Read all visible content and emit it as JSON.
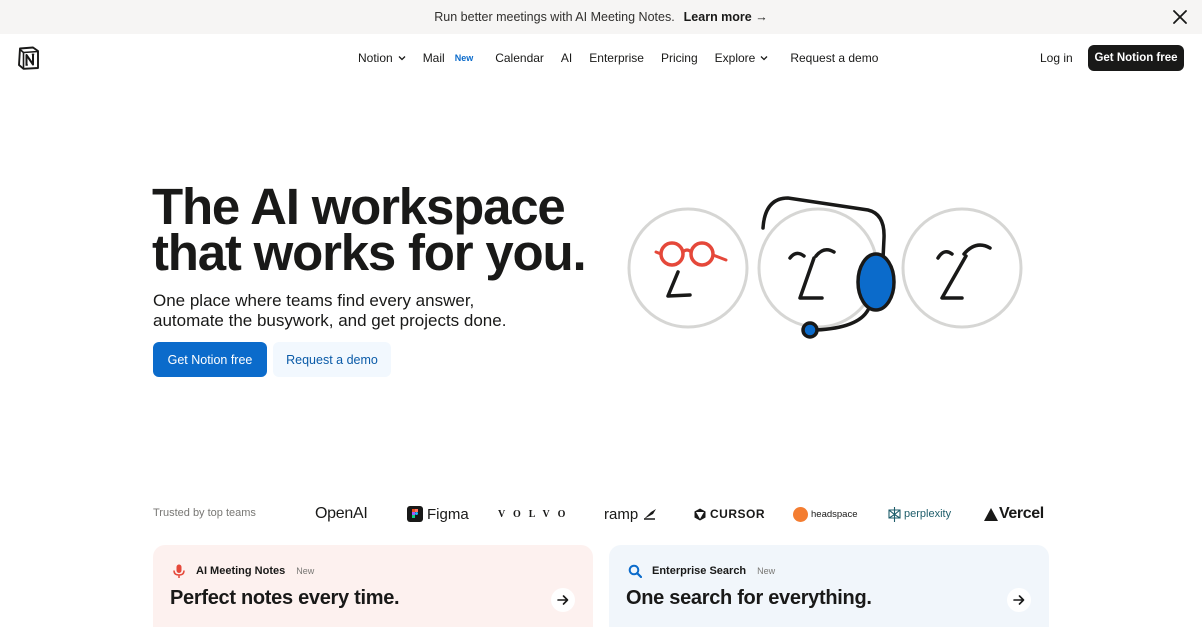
{
  "banner": {
    "text": "Run better meetings with AI Meeting Notes.",
    "link": "Learn more →"
  },
  "nav": {
    "items": [
      {
        "label": "Notion",
        "dropdown": true
      },
      {
        "label": "Mail",
        "badge": "New"
      },
      {
        "label": "Calendar"
      },
      {
        "label": "AI"
      },
      {
        "label": "Enterprise"
      },
      {
        "label": "Pricing"
      },
      {
        "label": "Explore",
        "dropdown": true
      },
      {
        "label": "Request a demo"
      }
    ],
    "login": "Log in",
    "cta": "Get Notion free"
  },
  "hero": {
    "title_line1": "The AI workspace",
    "title_line2": "that works for you.",
    "subtitle_line1": "One place where teams find every answer,",
    "subtitle_line2": "automate the busywork, and get projects done.",
    "primary_cta": "Get Notion free",
    "secondary_cta": "Request a demo"
  },
  "trusted": {
    "label": "Trusted by top teams",
    "brands": [
      "OpenAI",
      "Figma",
      "VOLVO",
      "ramp",
      "CURSOR",
      "headspace",
      "perplexity",
      "Vercel"
    ]
  },
  "cards": [
    {
      "tag": "AI Meeting Notes",
      "badge": "New",
      "title": "Perfect notes every time.",
      "icon": "microphone-icon"
    },
    {
      "tag": "Enterprise Search",
      "badge": "New",
      "title": "One search for everything.",
      "icon": "search-icon"
    }
  ],
  "colors": {
    "primary_blue": "#0b6bcb",
    "banner_bg": "#f6f5f4",
    "card_pink": "#fdf1ef",
    "card_blue": "#f1f6fb",
    "accent_red": "#e5483a"
  }
}
